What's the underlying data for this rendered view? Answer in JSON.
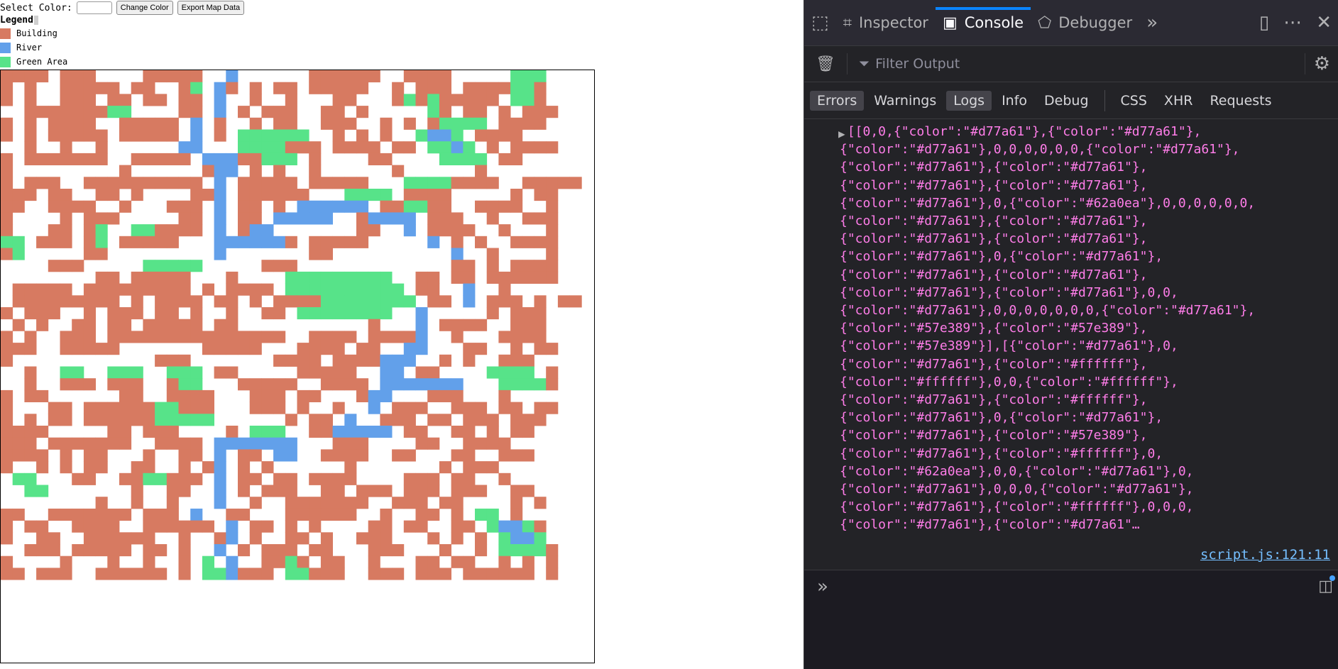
{
  "controls": {
    "select_color_label": "Select Color:",
    "change_color_label": "Change Color",
    "export_label": "Export Map Data"
  },
  "legend": {
    "title": "Legend",
    "items": [
      {
        "label": "Building",
        "color": "#d77a61"
      },
      {
        "label": "River",
        "color": "#62a0ea"
      },
      {
        "label": "Green Area",
        "color": "#57e389"
      }
    ]
  },
  "map": {
    "empty_color": "#ffffff",
    "rows": [
      "BBBB.BBB....BBBBB..R......BBBBBB..BBBB.....GGG.",
      "B.B..BBBBB.BB..BG.RB.B.BB.BBBBB..B.BBB.BBBBGGB",
      "B.B..BBB.BB.BB.BB.R..B..B...BB...BGBGBBBBB.GGB",
      "..BBBBBBBGG....BB.R.B.BBB..BB.B.....GB.BB.B.BBB",
      "B.B.BBBB..BBBBB.R.B..B.BB..BBB..B.B.BGGGG.BBBB",
      "B.B.BBBBB.BBBBB.R.B.GGGGGG..B.B.B..GRRG.BBBB",
      "..B..B..B......RR...GGGGBBB.BBBB.BB.GGRG.B.BBBB",
      "B.BBBBBBB..BBBBB.RRRBBGGG.B....BB....GGGG.BB..",
      "B.........B......BRR.B.B..B......B......B......",
      "B.BBB..BBBBBBBBBB.R.BBBBB.BBBBB...GGGGBBBB..BBBBB",
      "BBB.BB..BB.B....BBR.BBBBBB...GGGG.BBBB.....B.BB",
      "BB..BBBB..B...BBB.R.BB.B.RRRRRR.BBGGBB..BBBB..B",
      "B....B.BBB.....BB.R.BB.RRRRR..BRRRR.BBB..B..BBB",
      "B...BB.BG..GGBBBB.R.BRR.......BB..R.BBBB..B...B",
      "GG.BBB.BG.BBBBB...RRRRRRB.BBBBB.....R.B.B..BBBB",
      "BG.....BB.........R.......BB..........R..B....B",
      "....BBB.....GGGGG.....BBB.............BB.B.BBBB",
      "........BB.BBBBB...B....GGGGGGGGG..BB.BB.BBBBBB",
      ".BBBBB.BBBBBBBBB.B.BBBB.GGGGGGGGGG.BB..R..B....",
      ".BBBBBBBBB.B.BBBB.BB.B.BBBBGGGGGGGG.BB.R.BBB.B.BB",
      "B.BBB..B.BBB.BB.B..B..BB.GGGGGGGG..R.....B.BBB",
      ".B.B..BB.BB.BBBBB.BB...........B...R.BBBB..BBB",
      "B.B..BBB.BBBBBBBBBBBBBBB..BBBB.BBBBR..B...BBBB",
      "BBB..BBBBB.......BBBBB...BBBB.BB..RR...BB..B.BB",
      "B............BBB.......BBBB.BBBBRRR..B.B..BBB",
      "..B..GG..GGG..GGG.BB.....BBBBB..RR.BB....GGGG.B",
      "..B..BBB.BBB..BGG...BBBBB..BBBB.RRRRRRR...GGGGB",
      "B.BB......BB..BBBB...BBB.BB...BRR...BBB...B...",
      "B...BB.BBBBBBGGBBB...BBB.B..B..R.BBB..BBB.BB.BB",
      "B.B.BB.BBBBBBGGGGG......B.BB.R..BBB.BB.BBB.BBB",
      "BBBB.....BB.BBB....B.GGG..BBRRRRR.BB..BB.B.BB",
      "BBB.BBBBBBB..BBBB.RRRRRRR...BBB....BB..BBBB",
      "BBBB.B.BB...B..BB.R.BB.RR..BBBB..BB...BB..BBB.",
      "B..B.B.BB..BB..B.BR.B.B......B.......B.BBB....",
      ".GG...BB..BBGGBBB.R.BB.BB.BBBB....BBB.BB..B..",
      "..GG.......B..BB..R.B.BBB..BB.BBB.BBB.BBB..BB.",
      "........B..B..B...R..B..BBBBBBB..BBB.BB....B.B",
      "BB..BBBBBBB.BBB.R..BB...BBBBBB..B..BB.B.GG.B",
      "B.BB..BBBB..BBBBBB.R.BB.B.B....BB.BB..BB.GRRGB",
      "B..BB..BBBBBB..B..BR.B..BB.B..BBB...B.B.B.GRRG.",
      "..BBB.BBBBB.BB.B..R.B.BBB.BB...BBB...B..B.GGGGB",
      "B....B...B..B..B.G.R..BBGB.BB..B...BB.BB..B.B.B",
      "BB.BBB..BBBBBB.B.GGRBBB.GGBBB..BBB.BBB.BBBBBB.B"
    ],
    "legend_codes": {
      "B": "Building",
      "R": "River",
      "G": "Green Area"
    }
  },
  "devtools": {
    "tabs": [
      {
        "label": "Inspector",
        "icon": "inspector-icon",
        "active": false
      },
      {
        "label": "Console",
        "icon": "console-icon",
        "active": true
      },
      {
        "label": "Debugger",
        "icon": "debugger-icon",
        "active": false
      }
    ],
    "filter_placeholder": "Filter Output",
    "levels": [
      {
        "label": "Errors",
        "on": true
      },
      {
        "label": "Warnings",
        "on": false
      },
      {
        "label": "Logs",
        "on": true
      },
      {
        "label": "Info",
        "on": false
      },
      {
        "label": "Debug",
        "on": false
      }
    ],
    "types": [
      "CSS",
      "XHR",
      "Requests"
    ],
    "log_lines": [
      "[[0,0,{\"color\":\"#d77a61\"},{\"color\":\"#d77a61\"},",
      "{\"color\":\"#d77a61\"},0,0,0,0,0,0,{\"color\":\"#d77a61\"},",
      "{\"color\":\"#d77a61\"},{\"color\":\"#d77a61\"},",
      "{\"color\":\"#d77a61\"},{\"color\":\"#d77a61\"},",
      "{\"color\":\"#d77a61\"},0,{\"color\":\"#62a0ea\"},0,0,0,0,0,0,",
      "{\"color\":\"#d77a61\"},{\"color\":\"#d77a61\"},",
      "{\"color\":\"#d77a61\"},{\"color\":\"#d77a61\"},",
      "{\"color\":\"#d77a61\"},0,{\"color\":\"#d77a61\"},",
      "{\"color\":\"#d77a61\"},{\"color\":\"#d77a61\"},",
      "{\"color\":\"#d77a61\"},{\"color\":\"#d77a61\"},0,0,",
      "{\"color\":\"#d77a61\"},0,0,0,0,0,0,0,{\"color\":\"#d77a61\"},",
      "{\"color\":\"#57e389\"},{\"color\":\"#57e389\"},",
      "{\"color\":\"#57e389\"}],[{\"color\":\"#d77a61\"},0,",
      "{\"color\":\"#d77a61\"},{\"color\":\"#ffffff\"},",
      "{\"color\":\"#ffffff\"},0,0,{\"color\":\"#ffffff\"},",
      "{\"color\":\"#d77a61\"},{\"color\":\"#ffffff\"},",
      "{\"color\":\"#d77a61\"},0,{\"color\":\"#d77a61\"},",
      "{\"color\":\"#d77a61\"},{\"color\":\"#57e389\"},",
      "{\"color\":\"#d77a61\"},{\"color\":\"#ffffff\"},0,",
      "{\"color\":\"#62a0ea\"},0,0,{\"color\":\"#d77a61\"},0,",
      "{\"color\":\"#d77a61\"},0,0,0,{\"color\":\"#d77a61\"},",
      "{\"color\":\"#d77a61\"},{\"color\":\"#ffffff\"},0,0,0,",
      "{\"color\":\"#d77a61\"},{\"color\":\"#d77a61\"…"
    ],
    "source_link": "script.js:121:11"
  }
}
